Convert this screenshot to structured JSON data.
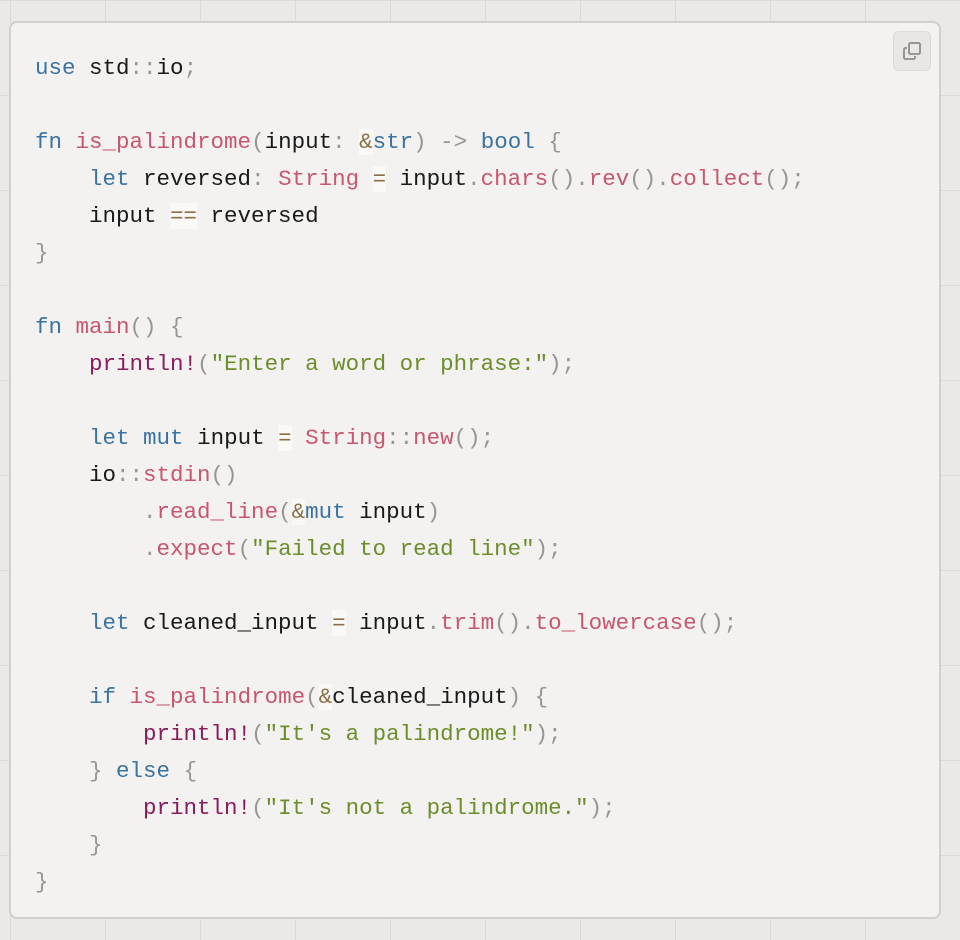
{
  "code_block": {
    "language": "rust",
    "copy_button": {
      "icon": "copy-icon",
      "label": "Copy"
    },
    "lines": [
      [
        {
          "t": "use",
          "c": "kw"
        },
        {
          "t": " std",
          "c": "id"
        },
        {
          "t": "::",
          "c": "pun"
        },
        {
          "t": "io",
          "c": "id"
        },
        {
          "t": ";",
          "c": "pun"
        }
      ],
      [],
      [
        {
          "t": "fn",
          "c": "kw"
        },
        {
          "t": " ",
          "c": "id"
        },
        {
          "t": "is_palindrome",
          "c": "fnn"
        },
        {
          "t": "(",
          "c": "pun"
        },
        {
          "t": "input",
          "c": "id"
        },
        {
          "t": ":",
          "c": "pun"
        },
        {
          "t": " ",
          "c": "id"
        },
        {
          "t": "&",
          "c": "op"
        },
        {
          "t": "str",
          "c": "kw"
        },
        {
          "t": ")",
          "c": "pun"
        },
        {
          "t": " -> ",
          "c": "pun"
        },
        {
          "t": "bool",
          "c": "kw"
        },
        {
          "t": " {",
          "c": "pun"
        }
      ],
      [
        {
          "t": "    ",
          "c": "id"
        },
        {
          "t": "let",
          "c": "kw"
        },
        {
          "t": " reversed",
          "c": "id"
        },
        {
          "t": ":",
          "c": "pun"
        },
        {
          "t": " ",
          "c": "id"
        },
        {
          "t": "String",
          "c": "ty"
        },
        {
          "t": " ",
          "c": "id"
        },
        {
          "t": "=",
          "c": "op"
        },
        {
          "t": " input",
          "c": "id"
        },
        {
          "t": ".",
          "c": "pun"
        },
        {
          "t": "chars",
          "c": "fnn"
        },
        {
          "t": "().",
          "c": "pun"
        },
        {
          "t": "rev",
          "c": "fnn"
        },
        {
          "t": "().",
          "c": "pun"
        },
        {
          "t": "collect",
          "c": "fnn"
        },
        {
          "t": "();",
          "c": "pun"
        }
      ],
      [
        {
          "t": "    input ",
          "c": "id"
        },
        {
          "t": "==",
          "c": "op"
        },
        {
          "t": " reversed",
          "c": "id"
        }
      ],
      [
        {
          "t": "}",
          "c": "pun"
        }
      ],
      [],
      [
        {
          "t": "fn",
          "c": "kw"
        },
        {
          "t": " ",
          "c": "id"
        },
        {
          "t": "main",
          "c": "fnn"
        },
        {
          "t": "() {",
          "c": "pun"
        }
      ],
      [
        {
          "t": "    ",
          "c": "id"
        },
        {
          "t": "println!",
          "c": "mac"
        },
        {
          "t": "(",
          "c": "pun"
        },
        {
          "t": "\"Enter a word or phrase:\"",
          "c": "str"
        },
        {
          "t": ");",
          "c": "pun"
        }
      ],
      [],
      [
        {
          "t": "    ",
          "c": "id"
        },
        {
          "t": "let",
          "c": "kw"
        },
        {
          "t": " ",
          "c": "id"
        },
        {
          "t": "mut",
          "c": "kw"
        },
        {
          "t": " input ",
          "c": "id"
        },
        {
          "t": "=",
          "c": "op"
        },
        {
          "t": " ",
          "c": "id"
        },
        {
          "t": "String",
          "c": "ty"
        },
        {
          "t": "::",
          "c": "pun"
        },
        {
          "t": "new",
          "c": "fnn"
        },
        {
          "t": "();",
          "c": "pun"
        }
      ],
      [
        {
          "t": "    io",
          "c": "id"
        },
        {
          "t": "::",
          "c": "pun"
        },
        {
          "t": "stdin",
          "c": "fnn"
        },
        {
          "t": "()",
          "c": "pun"
        }
      ],
      [
        {
          "t": "        ",
          "c": "id"
        },
        {
          "t": ".",
          "c": "pun"
        },
        {
          "t": "read_line",
          "c": "fnn"
        },
        {
          "t": "(",
          "c": "pun"
        },
        {
          "t": "&",
          "c": "op"
        },
        {
          "t": "mut",
          "c": "kw"
        },
        {
          "t": " input",
          "c": "id"
        },
        {
          "t": ")",
          "c": "pun"
        }
      ],
      [
        {
          "t": "        ",
          "c": "id"
        },
        {
          "t": ".",
          "c": "pun"
        },
        {
          "t": "expect",
          "c": "fnn"
        },
        {
          "t": "(",
          "c": "pun"
        },
        {
          "t": "\"Failed to read line\"",
          "c": "str"
        },
        {
          "t": ");",
          "c": "pun"
        }
      ],
      [],
      [
        {
          "t": "    ",
          "c": "id"
        },
        {
          "t": "let",
          "c": "kw"
        },
        {
          "t": " cleaned_input ",
          "c": "id"
        },
        {
          "t": "=",
          "c": "op"
        },
        {
          "t": " input",
          "c": "id"
        },
        {
          "t": ".",
          "c": "pun"
        },
        {
          "t": "trim",
          "c": "fnn"
        },
        {
          "t": "().",
          "c": "pun"
        },
        {
          "t": "to_lowercase",
          "c": "fnn"
        },
        {
          "t": "();",
          "c": "pun"
        }
      ],
      [],
      [
        {
          "t": "    ",
          "c": "id"
        },
        {
          "t": "if",
          "c": "kw"
        },
        {
          "t": " ",
          "c": "id"
        },
        {
          "t": "is_palindrome",
          "c": "fnn"
        },
        {
          "t": "(",
          "c": "pun"
        },
        {
          "t": "&",
          "c": "op"
        },
        {
          "t": "cleaned_input",
          "c": "id"
        },
        {
          "t": ") {",
          "c": "pun"
        }
      ],
      [
        {
          "t": "        ",
          "c": "id"
        },
        {
          "t": "println!",
          "c": "mac"
        },
        {
          "t": "(",
          "c": "pun"
        },
        {
          "t": "\"It's a palindrome!\"",
          "c": "str"
        },
        {
          "t": ");",
          "c": "pun"
        }
      ],
      [
        {
          "t": "    ",
          "c": "id"
        },
        {
          "t": "}",
          "c": "pun"
        },
        {
          "t": " ",
          "c": "id"
        },
        {
          "t": "else",
          "c": "kw"
        },
        {
          "t": " {",
          "c": "pun"
        }
      ],
      [
        {
          "t": "        ",
          "c": "id"
        },
        {
          "t": "println!",
          "c": "mac"
        },
        {
          "t": "(",
          "c": "pun"
        },
        {
          "t": "\"It's not a palindrome.\"",
          "c": "str"
        },
        {
          "t": ");",
          "c": "pun"
        }
      ],
      [
        {
          "t": "    ",
          "c": "id"
        },
        {
          "t": "}",
          "c": "pun"
        }
      ],
      [
        {
          "t": "}",
          "c": "pun"
        }
      ]
    ]
  },
  "colors": {
    "keyword": "#3a73a2",
    "function": "#c8566f",
    "macro": "#8a1c5c",
    "string": "#6b8e2b",
    "punctuation": "#999591",
    "operator": "#8a7048",
    "background": "#f3f2f0",
    "page": "#ece8e5"
  }
}
